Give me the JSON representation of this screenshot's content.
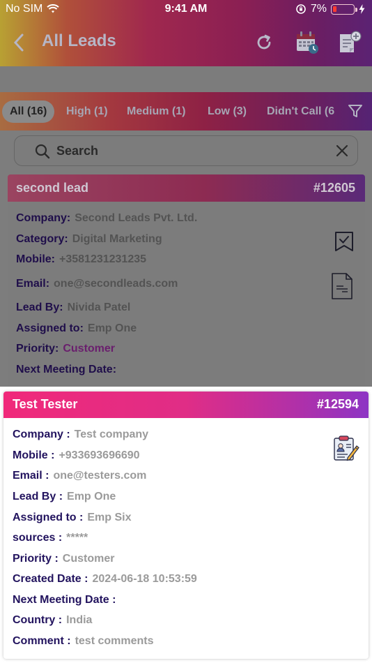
{
  "status": {
    "carrier": "No SIM",
    "time": "9:41 AM",
    "battery": "7%"
  },
  "header": {
    "title": "All Leads",
    "icons": [
      "back-chevron-icon",
      "refresh-icon",
      "calendar-icon",
      "add-note-icon"
    ]
  },
  "tabs": [
    {
      "label": "All (16)",
      "active": true
    },
    {
      "label": "High (1)"
    },
    {
      "label": "Medium (1)"
    },
    {
      "label": "Low (3)"
    },
    {
      "label": "Didn't Call (6"
    }
  ],
  "search": {
    "placeholder": "Search"
  },
  "lead1": {
    "name": "second lead",
    "number": "#12605",
    "rows": [
      {
        "label": "Company:",
        "value": "Second Leads Pvt. Ltd."
      },
      {
        "label": "Category:",
        "value": "Digital Marketing"
      },
      {
        "label": "Mobile:",
        "value": "+3581231231235"
      },
      {
        "label": "Email:",
        "value": "one@secondleads.com"
      },
      {
        "label": "Lead By:",
        "value": "Nividа Patel"
      },
      {
        "label": "Assigned to:",
        "value": "Emp One"
      },
      {
        "label": "Priority:",
        "value": "Customer"
      },
      {
        "label": "Next Meeting Date:",
        "value": ""
      }
    ]
  },
  "lead2": {
    "name": "Test Tester",
    "number": "#12594",
    "rows": [
      {
        "label": "Company :",
        "value": "Test company"
      },
      {
        "label": "Mobile :",
        "value": "+933693696690"
      },
      {
        "label": "Email :",
        "value": "one@testers.com"
      },
      {
        "label": "Lead By :",
        "value": "Emp One"
      },
      {
        "label": "Assigned to :",
        "value": "Emp Six"
      },
      {
        "label": "sources :",
        "value": "*****"
      },
      {
        "label": "Priority :",
        "value": "Customer"
      },
      {
        "label": "Created Date :",
        "value": "2024-06-18 10:53:59"
      },
      {
        "label": "Next Meeting Date :",
        "value": ""
      },
      {
        "label": "Country :",
        "value": "India"
      },
      {
        "label": "Comment :",
        "value": "test comments"
      }
    ]
  },
  "colors": {
    "header_gradient_start": "#f0297a",
    "header_gradient_end": "#8d34c4",
    "label_color": "#22135e",
    "value_color": "#9a9a9a"
  }
}
